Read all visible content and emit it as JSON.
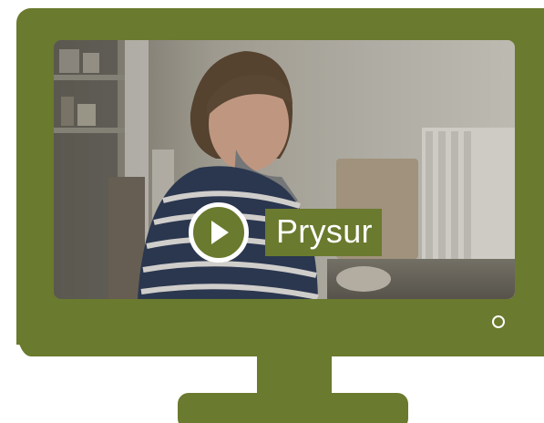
{
  "player": {
    "play_label": "Prysur"
  },
  "icons": {
    "play": "play-icon",
    "power": "power-indicator-icon"
  },
  "colors": {
    "tv_frame": "#6a7a2e",
    "play_label_bg": "#6a7a2e",
    "play_label_text": "#ffffff",
    "ring": "#ffffff"
  }
}
